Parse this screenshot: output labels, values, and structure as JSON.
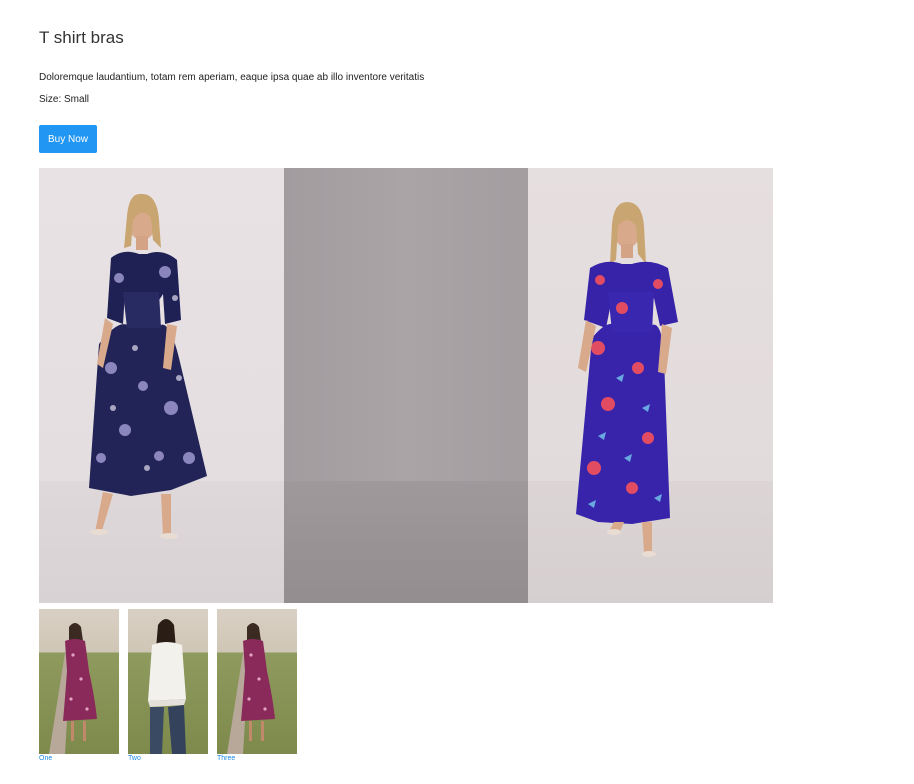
{
  "product": {
    "title": "T shirt bras",
    "description": "Doloremque laudantium, totam rem aperiam, eaque ipsa quae ab illo inventore veritatis",
    "size_text": "Size: Small",
    "buy_label": "Buy Now"
  },
  "gallery": {
    "slides": [
      {
        "alt": "model-dark-floral-dress"
      },
      {
        "alt": "blank-grey-backdrop"
      },
      {
        "alt": "model-blue-floral-dress"
      }
    ]
  },
  "thumbnails": [
    {
      "label": "One"
    },
    {
      "label": "Two"
    },
    {
      "label": "Three"
    }
  ],
  "colors": {
    "accent": "#2196f3",
    "link": "#1e88e5"
  }
}
